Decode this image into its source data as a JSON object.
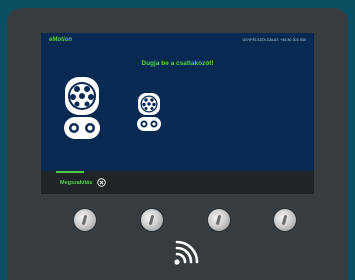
{
  "header": {
    "brand": "eMotion",
    "service_text": "ÜGYFÉLSZOLGÁLAT: +36 80 303 030"
  },
  "main": {
    "instruction": "Dugja be a csatlakozót!",
    "connectors": [
      {
        "icon": "ccs-connector-icon"
      },
      {
        "icon": "type2-connector-icon"
      }
    ]
  },
  "bottom_bar": {
    "cancel_label": "Megszakítás",
    "cancel_icon": "close-circle-icon"
  },
  "device": {
    "hardware_buttons": [
      "button-1",
      "button-2",
      "button-3",
      "button-4"
    ],
    "nfc_icon": "contactless-icon"
  },
  "colors": {
    "accent": "#55d24a",
    "screen_bg": "#082a52",
    "bezel": "#363c3f",
    "background": "#0b4f63"
  }
}
